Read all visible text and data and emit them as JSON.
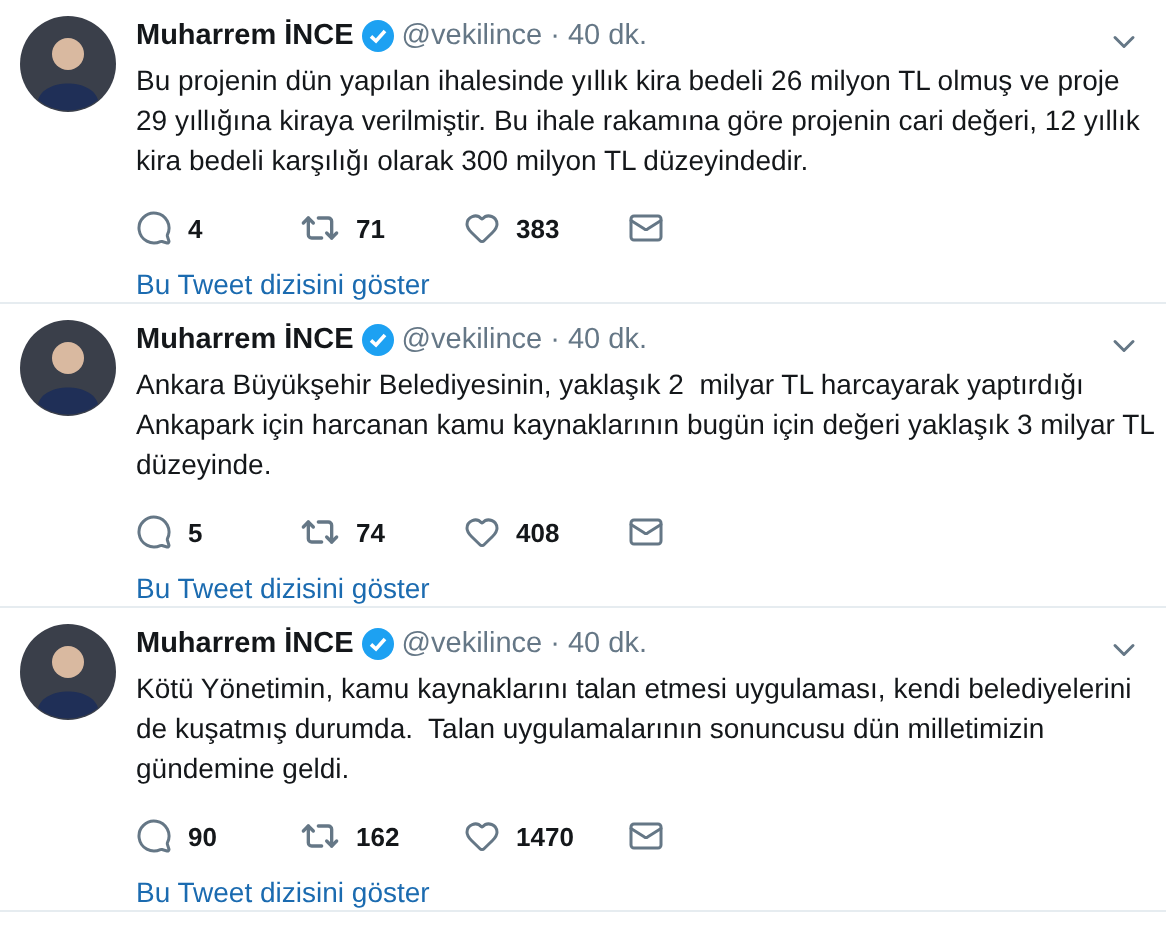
{
  "tweets": [
    {
      "name": "Muharrem İNCE",
      "handle": "@vekilince",
      "time": "· 40 dk.",
      "text": "Bu projenin dün yapılan ihalesinde yıllık kira bedeli 26 milyon TL olmuş ve proje\n29 yıllığına kiraya verilmiştir. Bu ihale rakamına göre projenin cari değeri, 12 yıllık\nkira bedeli karşılığı olarak 300 milyon TL düzeyindedir.",
      "replies": "4",
      "retweets": "71",
      "likes": "383",
      "thread_link": "Bu Tweet dizisini göster"
    },
    {
      "name": "Muharrem İNCE",
      "handle": "@vekilince",
      "time": "· 40 dk.",
      "text": "Ankara Büyükşehir Belediyesinin, yaklaşık 2  milyar TL harcayarak yaptırdığı\nAnkapark için harcanan kamu kaynaklarının bugün için değeri yaklaşık 3 milyar TL\ndüzeyinde.",
      "replies": "5",
      "retweets": "74",
      "likes": "408",
      "thread_link": "Bu Tweet dizisini göster"
    },
    {
      "name": "Muharrem İNCE",
      "handle": "@vekilince",
      "time": "· 40 dk.",
      "text": "Kötü Yönetimin, kamu kaynaklarını talan etmesi uygulaması, kendi belediyelerini\nde kuşatmış durumda.  Talan uygulamalarının sonuncusu dün milletimizin\ngündemine geldi.",
      "replies": "90",
      "retweets": "162",
      "likes": "1470",
      "thread_link": "Bu Tweet dizisini göster"
    }
  ]
}
